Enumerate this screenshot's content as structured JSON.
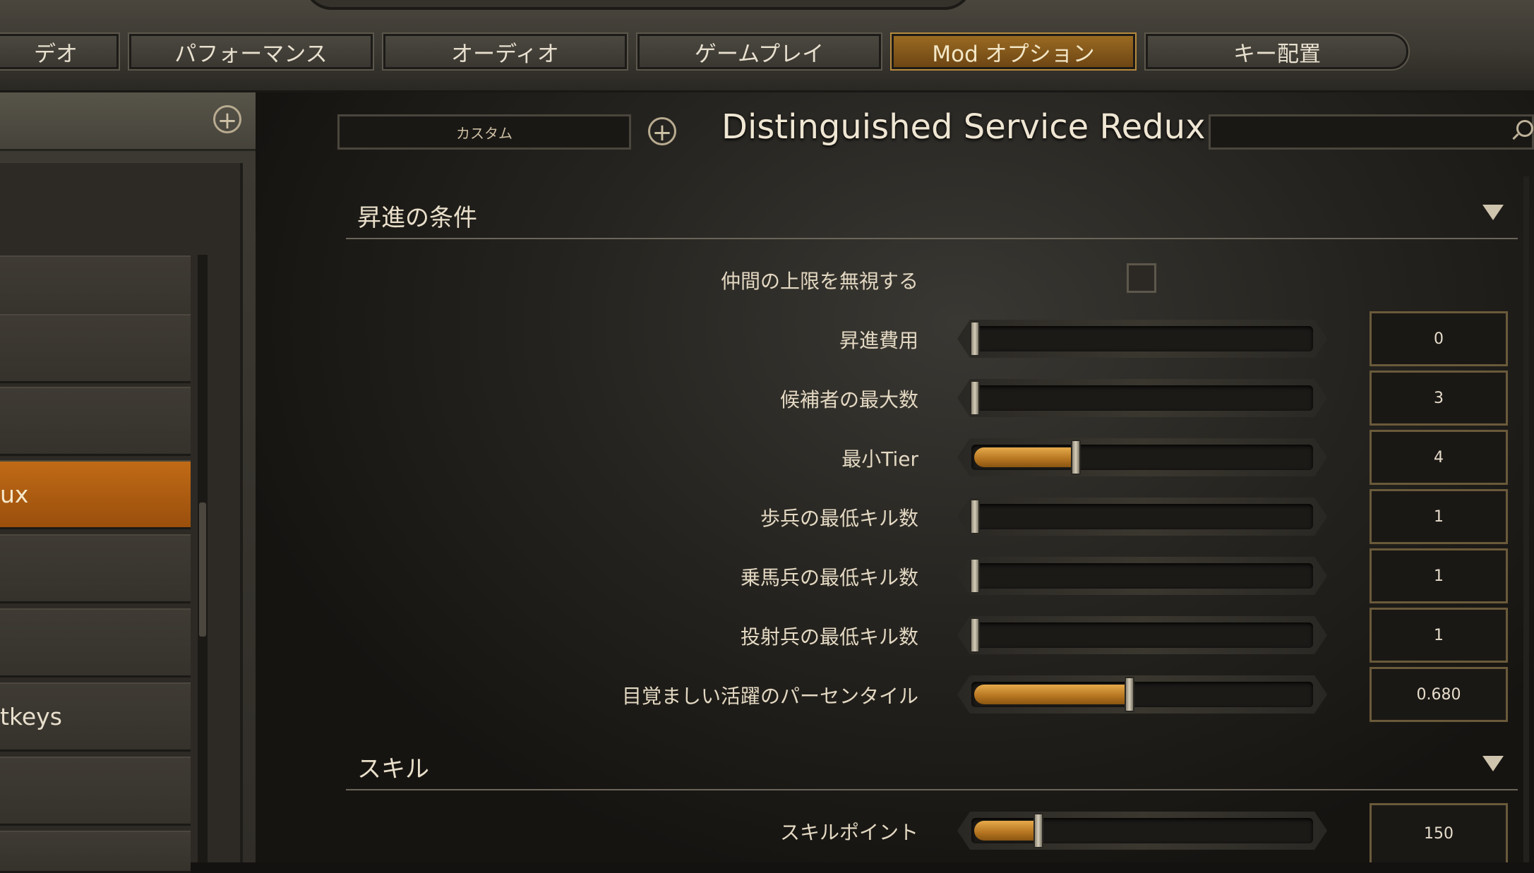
{
  "tabs": [
    {
      "label": "デオ",
      "active": false
    },
    {
      "label": "パフォーマンス",
      "active": false
    },
    {
      "label": "オーディオ",
      "active": false
    },
    {
      "label": "ゲームプレイ",
      "active": false
    },
    {
      "label": "Mod オプション",
      "active": true
    },
    {
      "label": "キー配置",
      "active": false
    }
  ],
  "sidebar": {
    "add_icon": "plus-circle-icon",
    "items": [
      {
        "label": "",
        "active": false
      },
      {
        "label": "",
        "active": false
      },
      {
        "label": "",
        "active": false
      },
      {
        "label": "ux",
        "active": true
      },
      {
        "label": "",
        "active": false
      },
      {
        "label": "",
        "active": false
      },
      {
        "label": "tkeys",
        "active": false
      },
      {
        "label": "",
        "active": false
      }
    ]
  },
  "header": {
    "preset_value": "カスタム",
    "add_icon": "plus-circle-icon",
    "mod_title": "Distinguished Service Redux",
    "search_icon": "search-icon"
  },
  "groups": [
    {
      "title": "昇進の条件",
      "settings": [
        {
          "label": "仲間の上限を無視する",
          "type": "checkbox",
          "checked": false
        },
        {
          "label": "昇進費用",
          "type": "slider",
          "value": "0",
          "fraction": 0.0
        },
        {
          "label": "候補者の最大数",
          "type": "slider",
          "value": "3",
          "fraction": 0.0
        },
        {
          "label": "最小Tier",
          "type": "slider",
          "value": "4",
          "fraction": 0.3
        },
        {
          "label": "歩兵の最低キル数",
          "type": "slider",
          "value": "1",
          "fraction": 0.0
        },
        {
          "label": "乗馬兵の最低キル数",
          "type": "slider",
          "value": "1",
          "fraction": 0.0
        },
        {
          "label": "投射兵の最低キル数",
          "type": "slider",
          "value": "1",
          "fraction": 0.0
        },
        {
          "label": "目覚ましい活躍のパーセンタイル",
          "type": "slider",
          "value": "0.680",
          "fraction": 0.46
        }
      ]
    },
    {
      "title": "スキル",
      "settings": [
        {
          "label": "スキルポイント",
          "type": "slider",
          "value": "150",
          "fraction": 0.19
        }
      ]
    }
  ],
  "colors": {
    "accent_orange": "#c06a16",
    "slider_fill": "#d19234",
    "text_light": "#e9dfca"
  }
}
